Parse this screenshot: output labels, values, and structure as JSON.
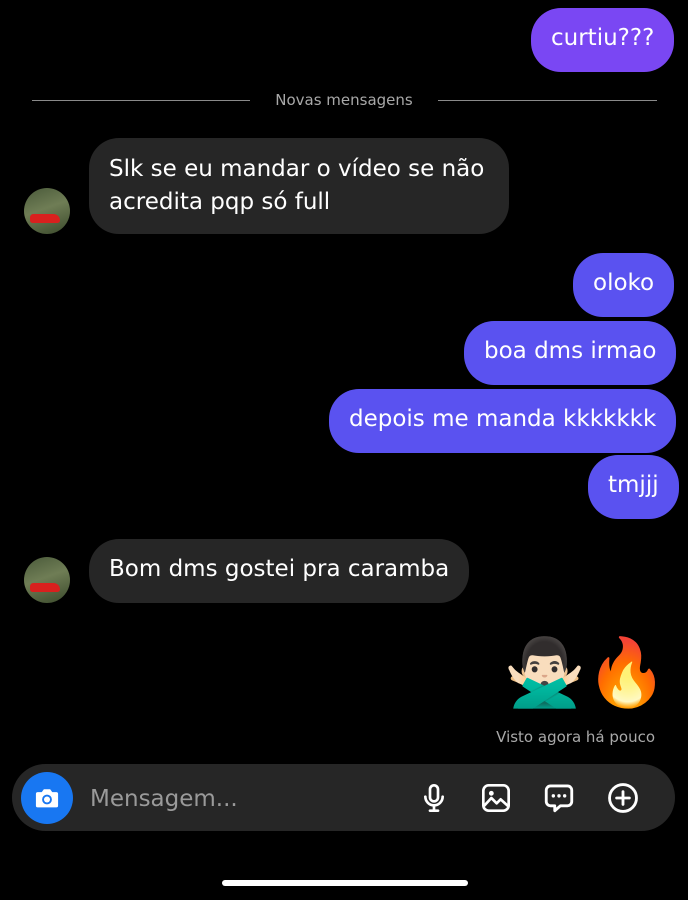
{
  "messages": {
    "m0": "curtiu???",
    "m1": "Slk se eu mandar o vídeo se não acredita pqp só full",
    "m2": "oloko",
    "m3": "boa dms irmao",
    "m4": "depois me manda kkkkkkk",
    "m5": "tmjjj",
    "m6": "Bom dms gostei pra caramba",
    "m7": "🙅🏻‍♂️🔥"
  },
  "divider_label": "Novas mensagens",
  "seen_status": "Visto agora há pouco",
  "composer": {
    "placeholder": "Mensagem..."
  },
  "icons": [
    "camera-icon",
    "microphone-icon",
    "image-icon",
    "sticker-icon",
    "plus-icon"
  ],
  "colors": {
    "outgoing": "#5a52f0",
    "outgoing_top": "#7a47f3",
    "incoming": "#262626",
    "camera_button": "#1877f2"
  }
}
